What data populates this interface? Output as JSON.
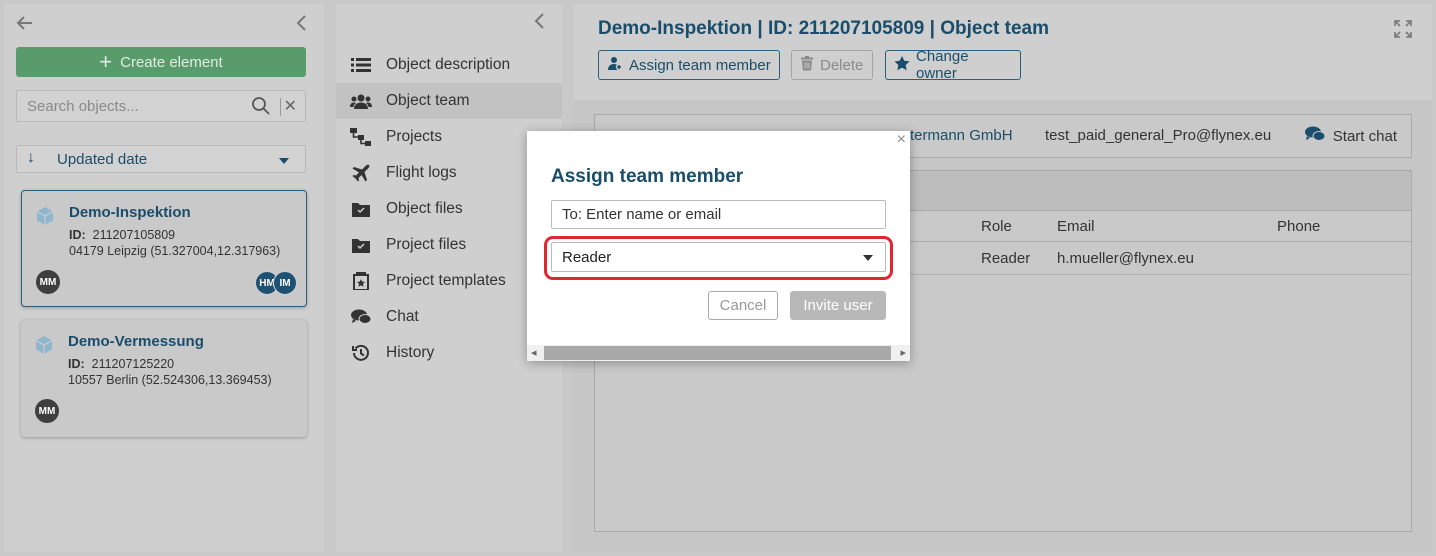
{
  "left_panel": {
    "create_label": "Create element",
    "search_placeholder": "Search objects...",
    "sort_label": "Updated date",
    "cards": [
      {
        "title": "Demo-Inspektion",
        "id_label": "ID:",
        "id_value": "211207105809",
        "location": "04179 Leipzig (51.327004,12.317963)",
        "owner_initials": "MM",
        "team_initials": [
          "HM",
          "IM"
        ],
        "selected": true
      },
      {
        "title": "Demo-Vermessung",
        "id_label": "ID:",
        "id_value": "211207125220",
        "location": "10557 Berlin (52.524306,13.369453)",
        "owner_initials": "MM",
        "selected": false
      }
    ]
  },
  "nav": {
    "items": [
      {
        "label": "Object description",
        "icon": "list-icon"
      },
      {
        "label": "Object team",
        "icon": "team-icon",
        "active": true
      },
      {
        "label": "Projects",
        "icon": "hierarchy-icon"
      },
      {
        "label": "Flight logs",
        "icon": "plane-icon"
      },
      {
        "label": "Object files",
        "icon": "folder-icon"
      },
      {
        "label": "Project files",
        "icon": "folder-icon"
      },
      {
        "label": "Project templates",
        "icon": "template-icon"
      },
      {
        "label": "Chat",
        "icon": "chat-icon"
      },
      {
        "label": "History",
        "icon": "history-icon"
      }
    ]
  },
  "main": {
    "title": "Demo-Inspektion | ID: 211207105809 | Object team",
    "toolbar": {
      "assign_label": "Assign team member",
      "delete_label": "Delete",
      "owner_label": "Change owner"
    },
    "owner": {
      "company": "termann GmbH",
      "email": "test_paid_general_Pro@flynex.eu",
      "chat_label": "Start chat"
    },
    "table": {
      "columns": {
        "role": "Role",
        "email": "Email",
        "phone": "Phone"
      },
      "rows": [
        {
          "role": "Reader",
          "email": "h.mueller@flynex.eu",
          "phone": ""
        }
      ]
    }
  },
  "modal": {
    "title": "Assign team member",
    "to_placeholder": "To: Enter name or email",
    "role_value": "Reader",
    "cancel_label": "Cancel",
    "invite_label": "Invite user"
  },
  "colors": {
    "accent": "#1a4d6b",
    "create_button": "#5a9b6c",
    "highlight": "#e0262e"
  }
}
